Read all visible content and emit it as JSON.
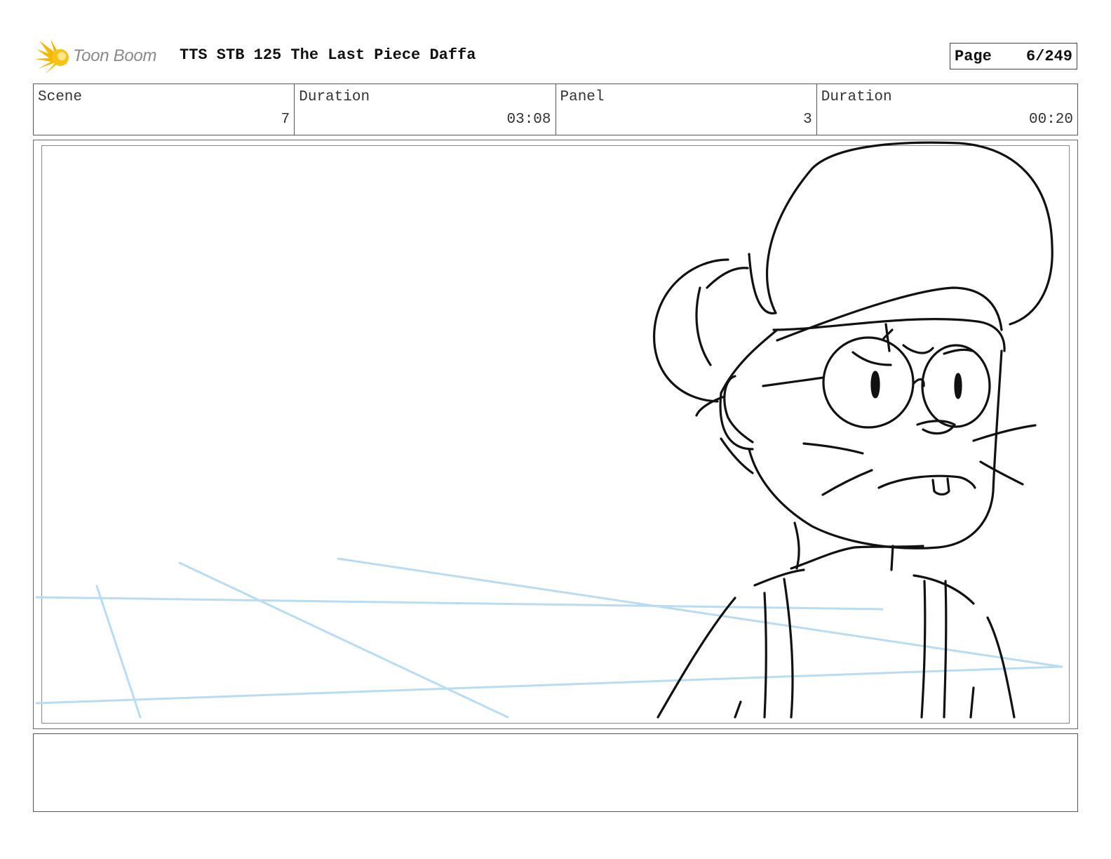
{
  "header": {
    "logo_text": "Toon Boom",
    "title": "TTS STB 125 The Last Piece Daffa",
    "page_label": "Page",
    "page_value": "6/249"
  },
  "info": {
    "scene_label": "Scene",
    "scene_value": "7",
    "scene_duration_label": "Duration",
    "scene_duration_value": "03:08",
    "panel_label": "Panel",
    "panel_value": "3",
    "panel_duration_label": "Duration",
    "panel_duration_value": "00:20"
  },
  "panel": {
    "drawing_icon": "character-sketch",
    "line_color": "#111111",
    "guide_color": "#b9dcf2"
  },
  "notes": {
    "text": ""
  },
  "colors": {
    "logo_burst": "#f5b800",
    "logo_text": "#8a8a8a"
  }
}
